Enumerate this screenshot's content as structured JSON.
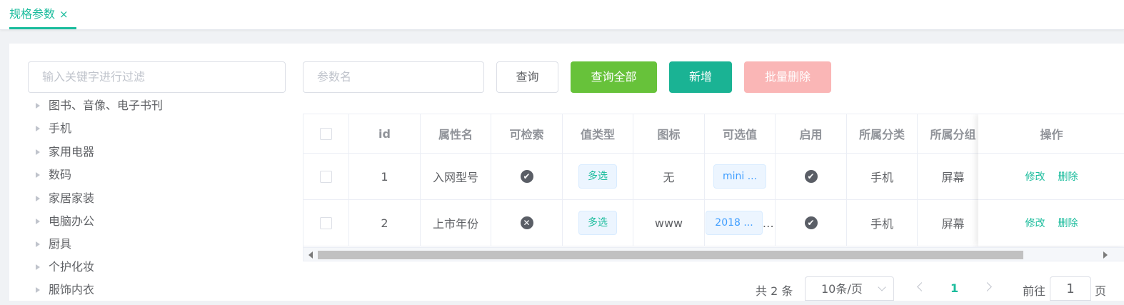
{
  "tabs": [
    {
      "label": "规格参数",
      "close": "×"
    }
  ],
  "tree": {
    "filter_placeholder": "输入关键字进行过滤",
    "items": [
      "图书、音像、电子书刊",
      "手机",
      "家用电器",
      "数码",
      "家居家装",
      "电脑办公",
      "厨具",
      "个护化妆",
      "服饰内衣"
    ]
  },
  "toolbar": {
    "search_placeholder": "参数名",
    "query_label": "查询",
    "query_all_label": "查询全部",
    "add_label": "新增",
    "batch_delete_label": "批量删除"
  },
  "table": {
    "columns": [
      "id",
      "属性名",
      "可检索",
      "值类型",
      "图标",
      "可选值",
      "启用",
      "所属分类",
      "所属分组",
      "操作"
    ],
    "rows": [
      {
        "id": "1",
        "name": "入网型号",
        "searchable": "check",
        "value_type": "多选",
        "icon": "无",
        "options": "mini ...",
        "options_extra": "",
        "enabled": "check",
        "category": "手机",
        "group": "屏幕",
        "edit": "修改",
        "delete": "删除"
      },
      {
        "id": "2",
        "name": "上市年份",
        "searchable": "x",
        "value_type": "多选",
        "icon": "www",
        "options": "2018 ...",
        "options_extra": "…",
        "enabled": "check",
        "category": "手机",
        "group": "屏幕",
        "edit": "修改",
        "delete": "删除"
      }
    ]
  },
  "pagination": {
    "total": "共 2 条",
    "page_size": "10条/页",
    "current_page": "1",
    "goto_label": "前往",
    "goto_value": "1",
    "page_suffix": "页"
  },
  "colors": {
    "accent": "#1abc9c",
    "green": "#67c23a",
    "teal": "#1ab394",
    "danger_light": "#fab6b6"
  }
}
